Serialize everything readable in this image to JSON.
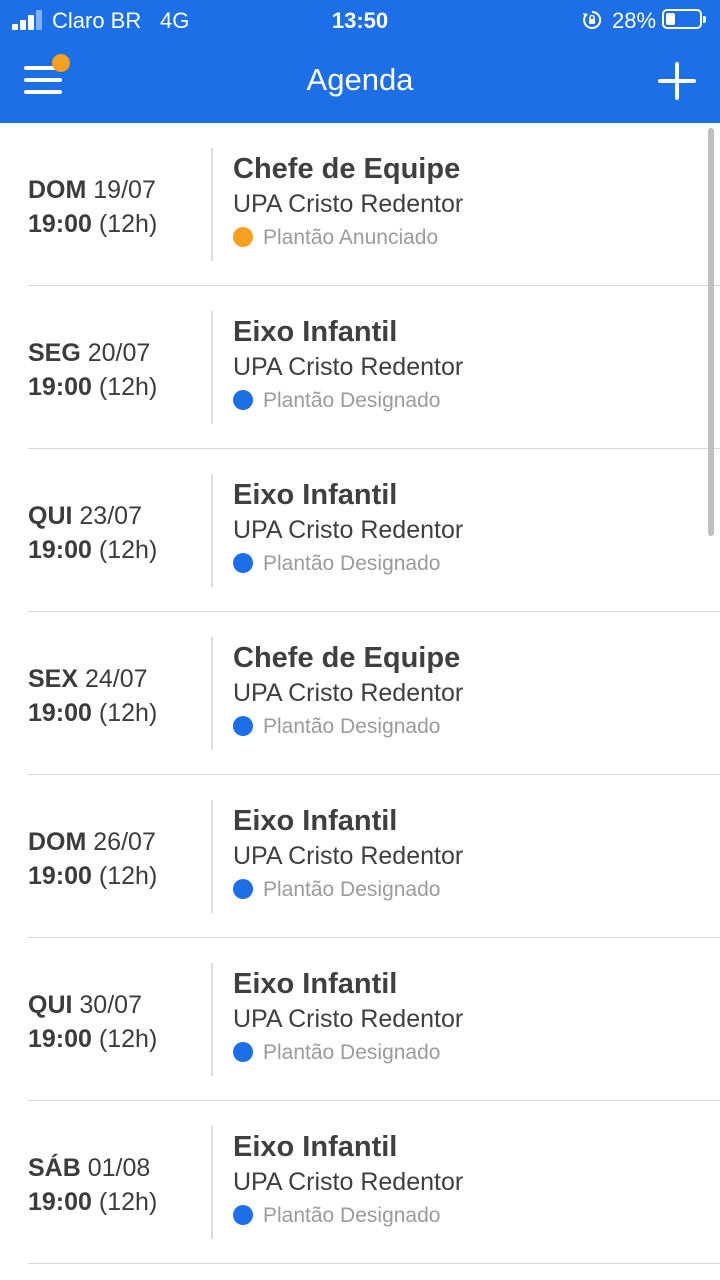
{
  "status_bar": {
    "carrier": "Claro BR",
    "network": "4G",
    "time": "13:50",
    "battery": "28%",
    "battery_level": 0.28
  },
  "nav": {
    "title": "Agenda",
    "menu_icon": "hamburger-menu-icon",
    "add_icon": "plus-icon",
    "badge_color": "#f5a01f"
  },
  "colors": {
    "brand": "#1d6fe8",
    "announced": "#f5a01f",
    "assigned": "#1d6fe8"
  },
  "shifts": [
    {
      "day": "DOM",
      "date": "19/07",
      "time": "19:00",
      "duration": "(12h)",
      "role": "Chefe de Equipe",
      "place": "UPA Cristo Redentor",
      "status": "Plantão Anunciado",
      "status_color": "#f5a01f"
    },
    {
      "day": "SEG",
      "date": "20/07",
      "time": "19:00",
      "duration": "(12h)",
      "role": "Eixo Infantil",
      "place": "UPA Cristo Redentor",
      "status": "Plantão Designado",
      "status_color": "#1d6fe8"
    },
    {
      "day": "QUI",
      "date": "23/07",
      "time": "19:00",
      "duration": "(12h)",
      "role": "Eixo Infantil",
      "place": "UPA Cristo Redentor",
      "status": "Plantão Designado",
      "status_color": "#1d6fe8"
    },
    {
      "day": "SEX",
      "date": "24/07",
      "time": "19:00",
      "duration": "(12h)",
      "role": "Chefe de Equipe",
      "place": "UPA Cristo Redentor",
      "status": "Plantão Designado",
      "status_color": "#1d6fe8"
    },
    {
      "day": "DOM",
      "date": "26/07",
      "time": "19:00",
      "duration": "(12h)",
      "role": "Eixo Infantil",
      "place": "UPA Cristo Redentor",
      "status": "Plantão Designado",
      "status_color": "#1d6fe8"
    },
    {
      "day": "QUI",
      "date": "30/07",
      "time": "19:00",
      "duration": "(12h)",
      "role": "Eixo Infantil",
      "place": "UPA Cristo Redentor",
      "status": "Plantão Designado",
      "status_color": "#1d6fe8"
    },
    {
      "day": "SÁB",
      "date": "01/08",
      "time": "19:00",
      "duration": "(12h)",
      "role": "Eixo Infantil",
      "place": "UPA Cristo Redentor",
      "status": "Plantão Designado",
      "status_color": "#1d6fe8"
    }
  ]
}
